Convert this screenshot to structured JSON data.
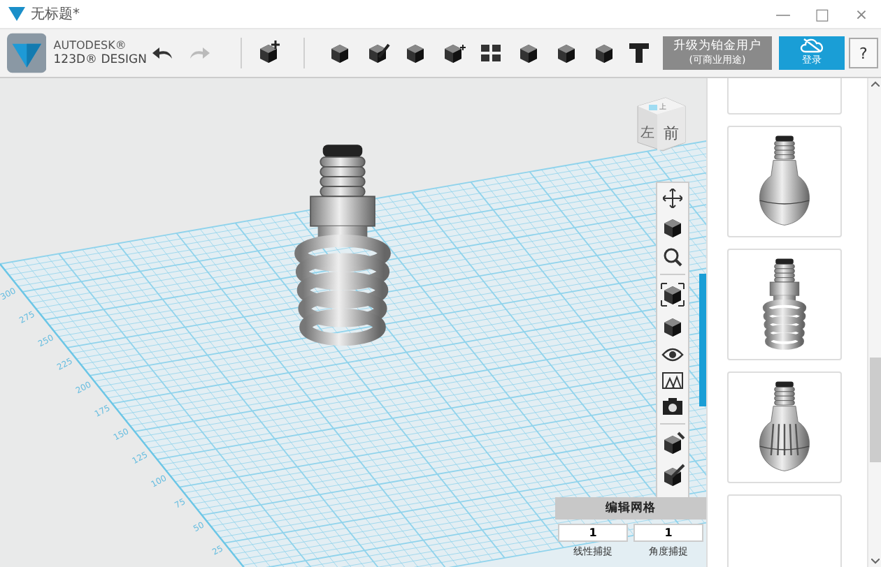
{
  "window": {
    "title": "无标题*",
    "controls": [
      "—",
      "□",
      "×"
    ]
  },
  "logo": {
    "brand": "AUTODESK®",
    "product": "123D® DESIGN"
  },
  "upgrade_button": {
    "label": "升级为铂金用户",
    "sublabel": "(可商业用途)"
  },
  "sign_in_button": {
    "label": "登录"
  },
  "help_button": {
    "label": "?"
  },
  "view_cube": {
    "faces": [
      "上",
      "左",
      "前"
    ]
  },
  "grid_axis_labels": [
    "300",
    "275",
    "250",
    "225",
    "200",
    "175",
    "150",
    "125",
    "100",
    "75",
    "50",
    "25"
  ],
  "edit_grid": {
    "title": "编辑网格",
    "fields": [
      {
        "value": "1",
        "label": "线性捕捉"
      },
      {
        "value": "1",
        "label": "角度捕捉"
      }
    ]
  }
}
